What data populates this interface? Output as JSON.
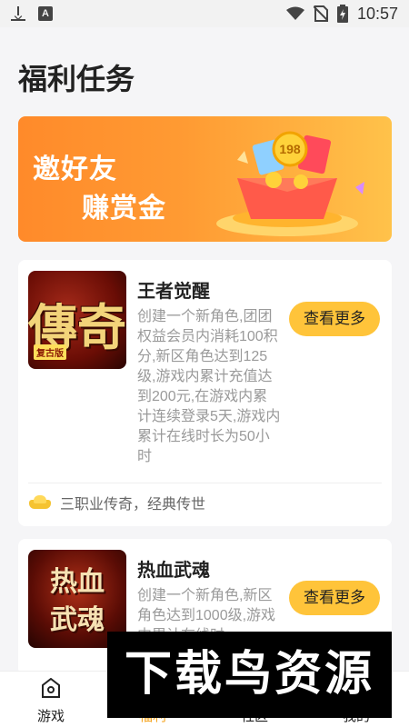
{
  "status_bar": {
    "time": "10:57"
  },
  "page": {
    "title": "福利任务"
  },
  "banner": {
    "line1": "邀好友",
    "line2": "赚赏金",
    "coin_label": "198"
  },
  "cards": [
    {
      "name": "王者觉醒",
      "thumb_text": "傳奇",
      "thumb_badge": "复古版",
      "description": "创建一个新角色,团团权益会员内消耗100积分,新区角色达到125级,游戏内累计充值达到200元,在游戏内累计连续登录5天,游戏内累计在线时长为50小时",
      "button_label": "查看更多",
      "tagline": "三职业传奇，经典传世"
    },
    {
      "name": "热血武魂",
      "thumb_text_top": "热血",
      "thumb_text_bottom": "武魂",
      "description": "创建一个新角色,新区角色达到1000级,游戏内累计在线时",
      "button_label": "查看更多"
    }
  ],
  "tab_bar": {
    "tabs": [
      {
        "label": "游戏",
        "icon": "game-icon",
        "active": false
      },
      {
        "label": "福利",
        "icon": "gift-icon",
        "active": true
      },
      {
        "label": "社区",
        "icon": "community-icon",
        "active": false
      },
      {
        "label": "我的",
        "icon": "profile-icon",
        "active": false
      }
    ]
  },
  "watermark": {
    "text": "下载鸟资源"
  },
  "colors": {
    "accent": "#ffc43a",
    "banner_start": "#ff8a2a",
    "banner_end": "#ffc24a",
    "active_tab": "#f5a623"
  }
}
